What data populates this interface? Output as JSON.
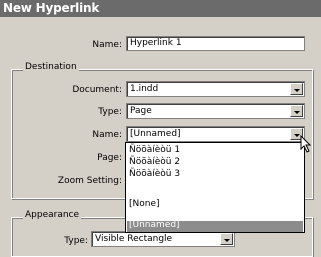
{
  "dialog": {
    "title": "New Hyperlink"
  },
  "name_field": {
    "label": "Name:",
    "value": "Hyperlink 1"
  },
  "destination": {
    "legend": "Destination",
    "document": {
      "label": "Document:",
      "value": "1.indd"
    },
    "type": {
      "label": "Type:",
      "value": "Page"
    },
    "name": {
      "label": "Name:",
      "value": "[Unnamed]"
    },
    "page": {
      "label": "Page:"
    },
    "zoom": {
      "label": "Zoom Setting:"
    }
  },
  "name_dropdown": {
    "options": [
      "Ñöõàíèòü 1",
      "Ñöõàíèòü 2",
      "Ñöõàíèòü 3",
      "[None]",
      "[Unnamed]"
    ],
    "selected": "[Unnamed]"
  },
  "appearance": {
    "legend": "Appearance",
    "type": {
      "label": "Type:",
      "value": "Visible Rectangle"
    }
  }
}
